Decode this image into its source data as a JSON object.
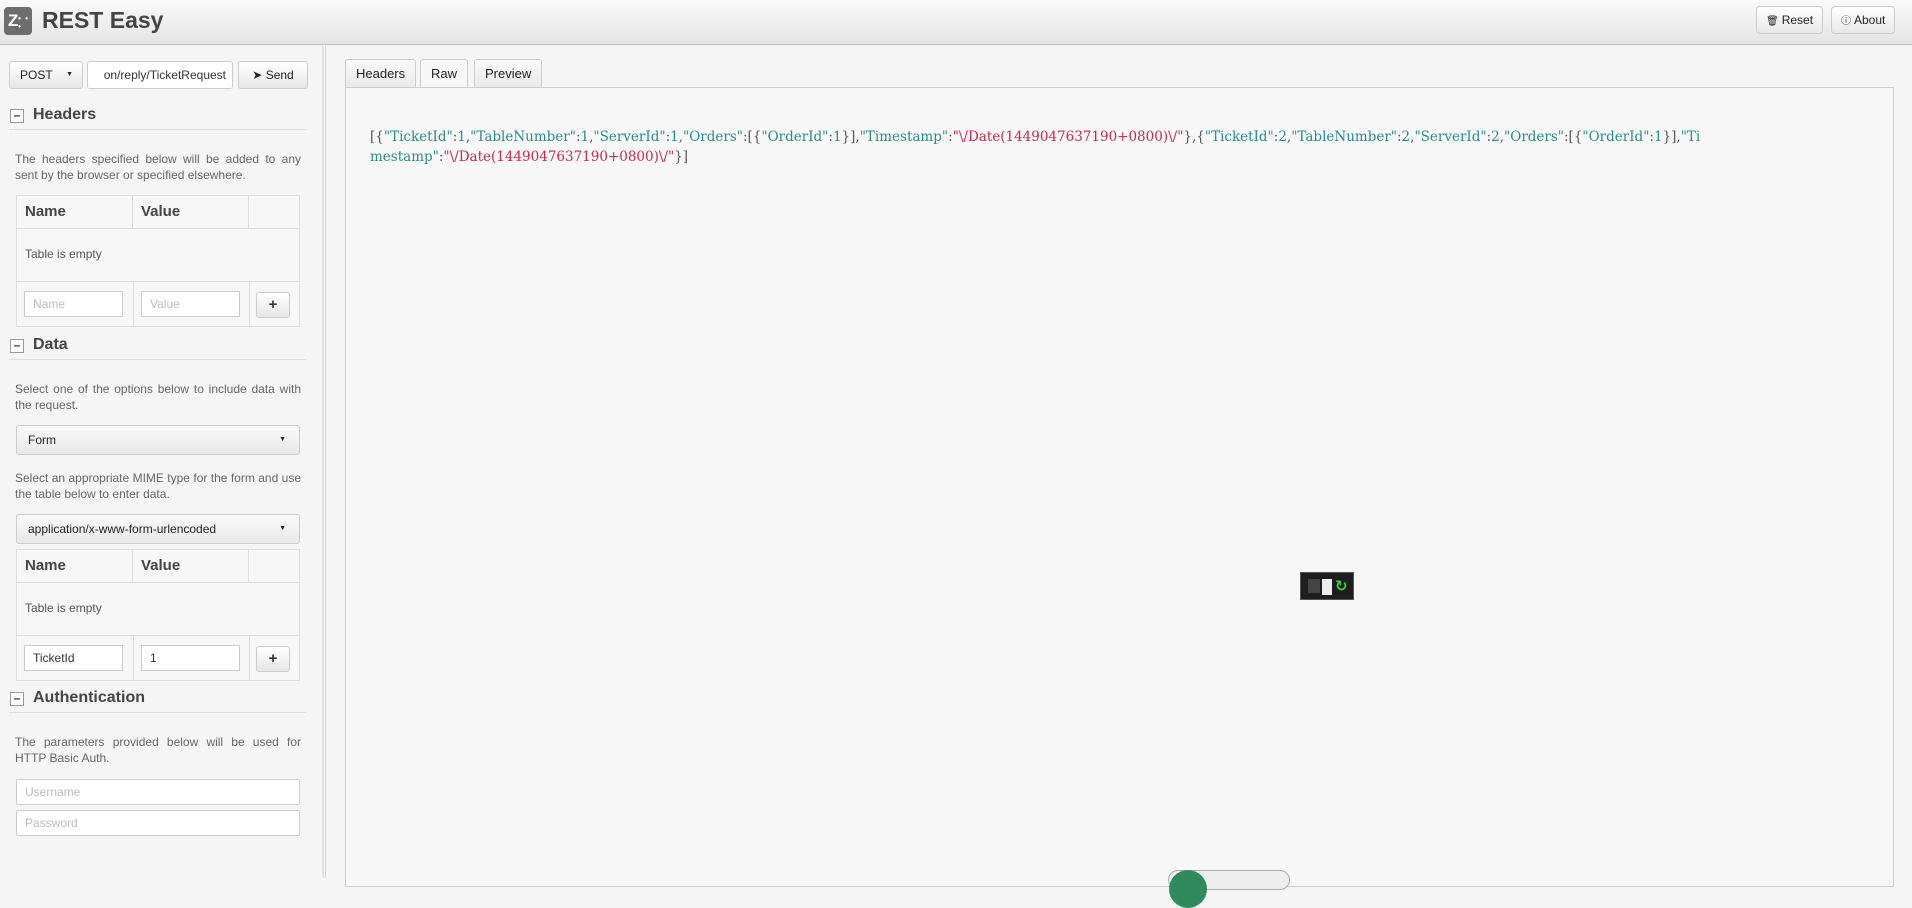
{
  "app": {
    "title": "REST Easy",
    "logo_letter": "Z",
    "reset_label": "Reset",
    "about_label": "About"
  },
  "request": {
    "method": "POST",
    "url_visible": "on/reply/TicketRequest",
    "send_label": "Send"
  },
  "headers_section": {
    "title": "Headers",
    "help": "The headers specified below will be added to any sent by the browser or specified elsewhere.",
    "col_name": "Name",
    "col_value": "Value",
    "empty_text": "Table is empty",
    "name_placeholder": "Name",
    "value_placeholder": "Value"
  },
  "data_section": {
    "title": "Data",
    "help": "Select one of the options below to include data with the request.",
    "data_type": "Form",
    "mime_help": "Select an appropriate MIME type for the form and use the table below to enter data.",
    "mime_type": "application/x-www-form-urlencoded",
    "col_name": "Name",
    "col_value": "Value",
    "empty_text": "Table is empty",
    "name_value": "TicketId",
    "value_value": "1"
  },
  "auth_section": {
    "title": "Authentication",
    "help": "The parameters provided below will be used for HTTP Basic Auth.",
    "username_placeholder": "Username",
    "password_placeholder": "Password"
  },
  "tabs": [
    "Headers",
    "Raw",
    "Preview"
  ],
  "active_tab": "Raw",
  "response_raw": "[{\"TicketId\":1,\"TableNumber\":1,\"ServerId\":1,\"Orders\":[{\"OrderId\":1}],\"Timestamp\":\"\\/Date(1449047637190+0800)\\/\"},{\"TicketId\":2,\"TableNumber\":2,\"ServerId\":2,\"Orders\":[{\"OrderId\":1}],\"Timestamp\":\"\\/Date(1449047637190+0800)\\/\"}]",
  "colors": {
    "json_key": "#2a8a8a",
    "json_string": "#c8294b",
    "header_bg": "#e4e4e4"
  }
}
